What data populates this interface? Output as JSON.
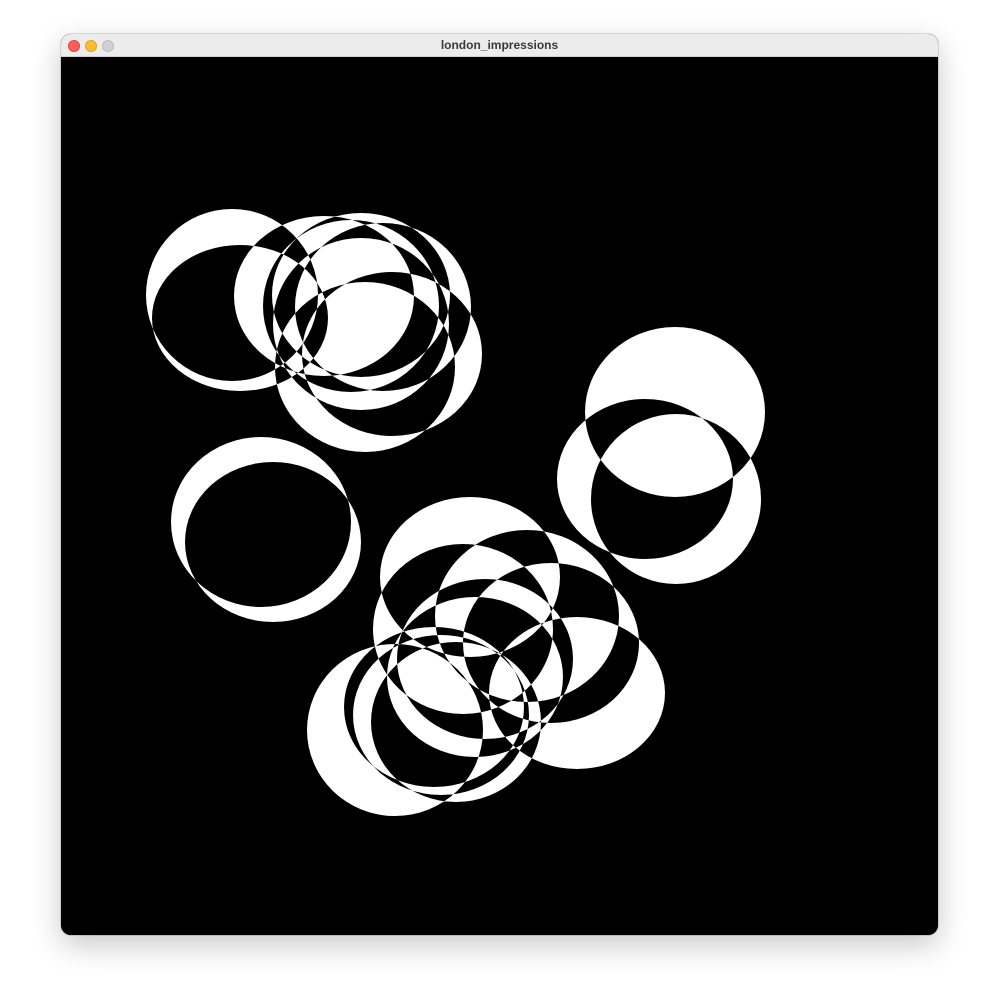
{
  "window": {
    "title": "london_impressions",
    "buttons": {
      "close": "close-button",
      "minimize": "minimize-button",
      "zoom": "zoom-button"
    }
  },
  "sketch": {
    "background": "#000000",
    "fill": "#ffffff",
    "blend": "xor"
  },
  "colors": {
    "titlebar": "#ececec",
    "close": "#fe5f57",
    "minimize": "#febc2e",
    "zoom": "#d1d1d1"
  }
}
